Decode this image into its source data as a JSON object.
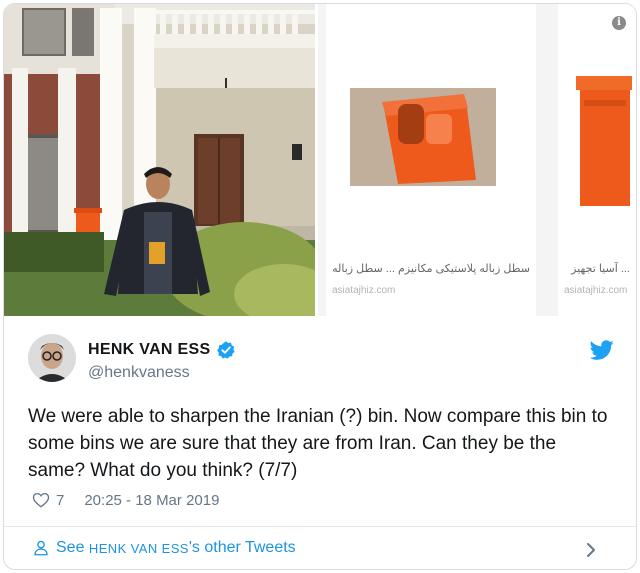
{
  "search_results": [
    {
      "caption": "سطل زباله پلاستیکی مکانیزم ... سطل زباله پ",
      "domain": "asiatajhiz.com"
    },
    {
      "caption": "... آسیا تجهیز",
      "domain": "asiatajhiz.com"
    }
  ],
  "tweet": {
    "display_name": "HENK VAN ESS",
    "handle": "@henkvaness",
    "text": "We were able to sharpen the Iranian (?) bin. Now compare this bin to some bins we are sure that they are from Iran. Can they be the same? What do you think?  (7/7)",
    "like_count": "7",
    "timestamp": "20:25 - 18 Mar 2019"
  },
  "footer": {
    "see_prefix": "See",
    "name": "HENK VAN ESS",
    "suffix": "'s other Tweets"
  },
  "colors": {
    "twitter_blue": "#1da1f2",
    "link_blue": "#1b95e0",
    "bin_orange": "#ee5a1c",
    "muted_text": "#657786"
  },
  "icons": [
    "info-icon",
    "verified-badge-icon",
    "twitter-bird-icon",
    "heart-icon",
    "person-icon",
    "chevron-right-icon"
  ]
}
